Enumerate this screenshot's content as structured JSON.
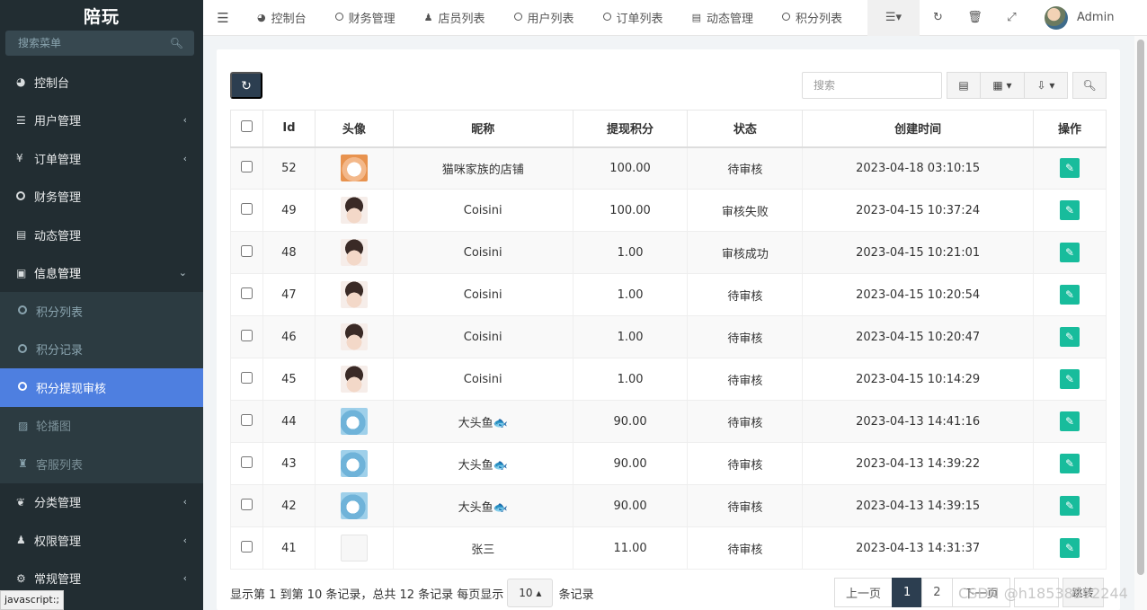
{
  "brand": "陪玩",
  "sidebar": {
    "search_placeholder": "搜索菜单",
    "items": [
      {
        "label": "控制台",
        "icon": "dashboard-icon",
        "glyph": "◕"
      },
      {
        "label": "用户管理",
        "icon": "list-icon",
        "glyph": "☰"
      },
      {
        "label": "订单管理",
        "icon": "yen-icon",
        "glyph": "¥"
      },
      {
        "label": "财务管理",
        "icon": "circle-icon",
        "glyph": ""
      },
      {
        "label": "动态管理",
        "icon": "book-icon",
        "glyph": "▤"
      },
      {
        "label": "信息管理",
        "icon": "newspaper-icon",
        "glyph": "▣"
      }
    ],
    "submenu": [
      {
        "label": "积分列表"
      },
      {
        "label": "积分记录"
      },
      {
        "label": "积分提现审核"
      },
      {
        "label": "轮播图",
        "glyph": "▨"
      },
      {
        "label": "客服列表",
        "glyph": "♜"
      }
    ],
    "bottom_items": [
      {
        "label": "分类管理",
        "glyph": "❦"
      },
      {
        "label": "权限管理",
        "glyph": "♟"
      },
      {
        "label": "常规管理",
        "glyph": "⚙"
      }
    ]
  },
  "status_url": "javascript:;",
  "topbar": {
    "tabs": [
      {
        "label": "控制台",
        "glyph": "◕"
      },
      {
        "label": "财务管理",
        "glyph": "ring"
      },
      {
        "label": "店员列表",
        "glyph": "♟"
      },
      {
        "label": "用户列表",
        "glyph": "ring"
      },
      {
        "label": "订单列表",
        "glyph": "ring"
      },
      {
        "label": "动态管理",
        "glyph": "▤"
      },
      {
        "label": "积分列表",
        "glyph": "ring"
      }
    ],
    "user_name": "Admin"
  },
  "toolbar": {
    "search_placeholder": "搜索"
  },
  "table": {
    "headers": [
      "Id",
      "头像",
      "昵称",
      "提现积分",
      "状态",
      "创建时间",
      "操作"
    ],
    "rows": [
      {
        "id": "52",
        "avatar": "cat",
        "nickname": "猫咪家族的店铺",
        "points": "100.00",
        "status": "待审核",
        "created": "2023-04-18 03:10:15"
      },
      {
        "id": "49",
        "avatar": "boy",
        "nickname": "Coisini",
        "points": "100.00",
        "status": "审核失败",
        "created": "2023-04-15 10:37:24"
      },
      {
        "id": "48",
        "avatar": "boy",
        "nickname": "Coisini",
        "points": "1.00",
        "status": "审核成功",
        "created": "2023-04-15 10:21:01"
      },
      {
        "id": "47",
        "avatar": "boy",
        "nickname": "Coisini",
        "points": "1.00",
        "status": "待审核",
        "created": "2023-04-15 10:20:54"
      },
      {
        "id": "46",
        "avatar": "boy",
        "nickname": "Coisini",
        "points": "1.00",
        "status": "待审核",
        "created": "2023-04-15 10:20:47"
      },
      {
        "id": "45",
        "avatar": "boy",
        "nickname": "Coisini",
        "points": "1.00",
        "status": "待审核",
        "created": "2023-04-15 10:14:29"
      },
      {
        "id": "44",
        "avatar": "fish",
        "nickname": "大头鱼🐟",
        "points": "90.00",
        "status": "待审核",
        "created": "2023-04-13 14:41:16"
      },
      {
        "id": "43",
        "avatar": "fish",
        "nickname": "大头鱼🐟",
        "points": "90.00",
        "status": "待审核",
        "created": "2023-04-13 14:39:22"
      },
      {
        "id": "42",
        "avatar": "fish",
        "nickname": "大头鱼🐟",
        "points": "90.00",
        "status": "待审核",
        "created": "2023-04-13 14:39:15"
      },
      {
        "id": "41",
        "avatar": "sketch",
        "nickname": "张三",
        "points": "11.00",
        "status": "待审核",
        "created": "2023-04-13 14:31:37"
      }
    ]
  },
  "footer": {
    "summary": "显示第 1 到第 10 条记录，总共 12 条记录 每页显示",
    "page_size": "10",
    "suffix": "条记录",
    "prev": "上一页",
    "pages": [
      "1",
      "2"
    ],
    "next": "下一页",
    "jump": "跳转"
  },
  "watermark": "CSDN @h18538592244"
}
